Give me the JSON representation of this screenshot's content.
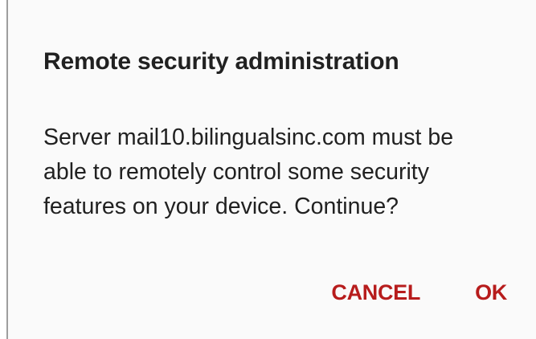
{
  "dialog": {
    "title": "Remote security administration",
    "message_lines": [
      "Server mail10.bilingualsinc.com must be",
      "able to remotely control some security",
      "features on your device. Continue?"
    ],
    "cancel_label": "CANCEL",
    "ok_label": "OK"
  },
  "colors": {
    "background": "#fafafa",
    "text": "#212121",
    "accent": "#b71c1c"
  }
}
